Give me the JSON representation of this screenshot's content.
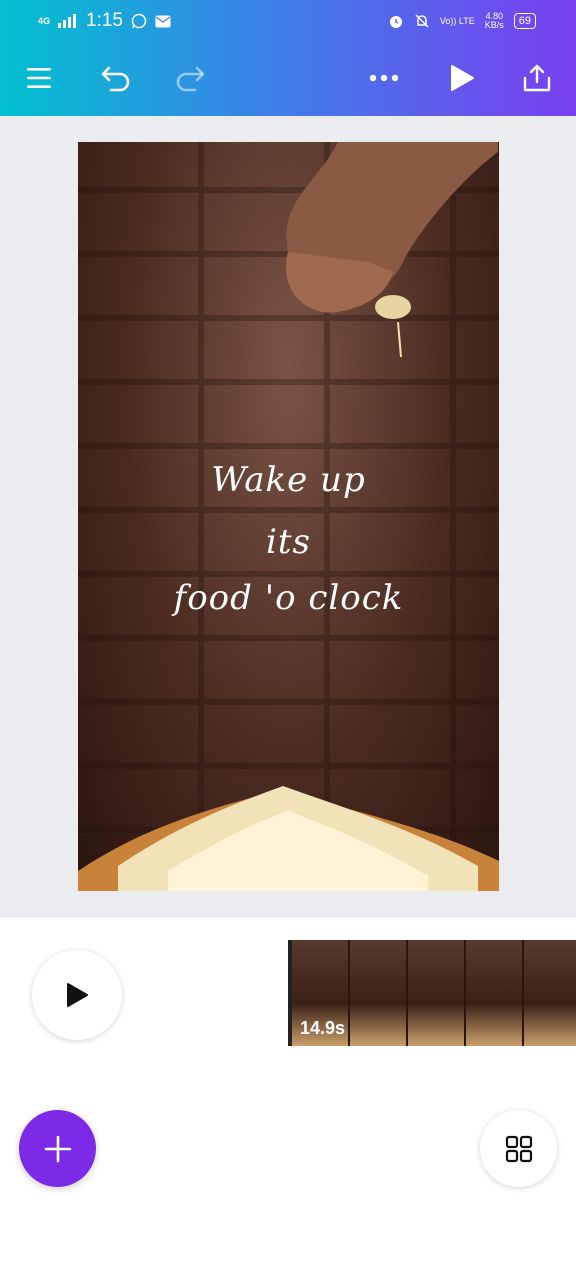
{
  "status_bar": {
    "network": "4G",
    "time": "1:15",
    "volte": "Vo)) LTE",
    "speed_value": "4.80",
    "speed_unit": "KB/s",
    "battery": "69",
    "icons": [
      "whatsapp-icon",
      "message-icon",
      "alarm-icon",
      "bell-off-icon"
    ]
  },
  "toolbar": {
    "icons": [
      "menu-icon",
      "undo-icon",
      "redo-icon",
      "more-icon",
      "play-icon",
      "share-icon"
    ]
  },
  "design": {
    "tagline": [
      "Wake up",
      "its",
      "food 'o clock"
    ]
  },
  "timeline": {
    "duration": "14.9s",
    "thumb_count": 5
  },
  "colors": {
    "gradient_start": "#00c1cf",
    "gradient_end": "#7a3ff0",
    "fab": "#7d2ae8"
  }
}
